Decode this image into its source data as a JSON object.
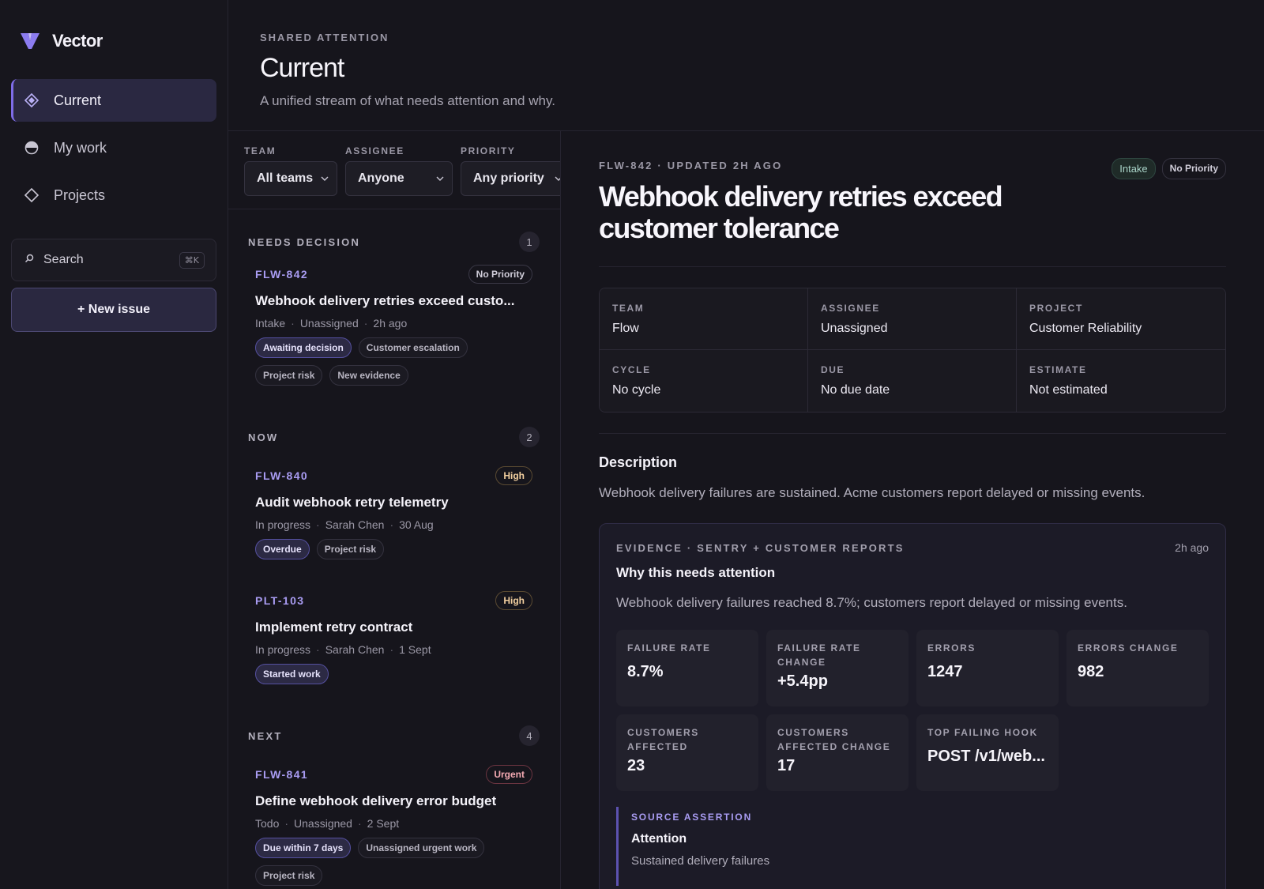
{
  "brand": {
    "name": "Vector"
  },
  "nav": [
    {
      "label": "Current",
      "icon": "diamond-filled-icon",
      "active": true
    },
    {
      "label": "My work",
      "icon": "half-circle-icon",
      "active": false
    },
    {
      "label": "Projects",
      "icon": "diamond-outline-icon",
      "active": false
    }
  ],
  "search": {
    "label": "Search",
    "shortcut": "⌘K"
  },
  "new_issue": {
    "label": "+ New issue"
  },
  "header": {
    "eyebrow": "SHARED ATTENTION",
    "title": "Current",
    "subtitle": "A unified stream of what needs attention and why."
  },
  "filters": [
    {
      "label": "TEAM",
      "value": "All teams"
    },
    {
      "label": "ASSIGNEE",
      "value": "Anyone"
    },
    {
      "label": "PRIORITY",
      "value": "Any priority"
    }
  ],
  "sections": [
    {
      "title": "NEEDS DECISION",
      "count": "1",
      "items": [
        {
          "id": "FLW-842",
          "priority": "No Priority",
          "title": "Webhook delivery retries exceed custo...",
          "meta": [
            "Intake",
            "Unassigned",
            "2h ago"
          ],
          "tags": [
            {
              "label": "Awaiting decision",
              "hl": true
            },
            {
              "label": "Customer escalation"
            },
            {
              "label": "Project risk"
            },
            {
              "label": "New evidence"
            }
          ]
        }
      ]
    },
    {
      "title": "NOW",
      "count": "2",
      "items": [
        {
          "id": "FLW-840",
          "priority": "High",
          "title": "Audit webhook retry telemetry",
          "meta": [
            "In progress",
            "Sarah Chen",
            "30 Aug"
          ],
          "tags": [
            {
              "label": "Overdue",
              "hl": true
            },
            {
              "label": "Project risk"
            }
          ]
        },
        {
          "id": "PLT-103",
          "priority": "High",
          "title": "Implement retry contract",
          "meta": [
            "In progress",
            "Sarah Chen",
            "1 Sept"
          ],
          "tags": [
            {
              "label": "Started work",
              "hl": true
            }
          ]
        }
      ]
    },
    {
      "title": "NEXT",
      "count": "4",
      "items": [
        {
          "id": "FLW-841",
          "priority": "Urgent",
          "title": "Define webhook delivery error budget",
          "meta": [
            "Todo",
            "Unassigned",
            "2 Sept"
          ],
          "tags": [
            {
              "label": "Due within 7 days",
              "hl": true
            },
            {
              "label": "Unassigned urgent work"
            },
            {
              "label": "Project risk"
            }
          ]
        }
      ]
    }
  ],
  "detail": {
    "eyebrow": "FLW-842 · UPDATED 2H AGO",
    "badges": [
      "Intake",
      "No Priority"
    ],
    "title": "Webhook delivery retries exceed customer tolerance",
    "props": [
      {
        "label": "TEAM",
        "value": "Flow"
      },
      {
        "label": "ASSIGNEE",
        "value": "Unassigned"
      },
      {
        "label": "PROJECT",
        "value": "Customer Reliability"
      },
      {
        "label": "CYCLE",
        "value": "No cycle"
      },
      {
        "label": "DUE",
        "value": "No due date"
      },
      {
        "label": "ESTIMATE",
        "value": "Not estimated"
      }
    ],
    "description_title": "Description",
    "description": "Webhook delivery failures are sustained. Acme customers report delayed or missing events.",
    "evidence": {
      "eyebrow": "EVIDENCE · SENTRY + CUSTOMER REPORTS",
      "time": "2h ago",
      "title": "Why this needs attention",
      "text": "Webhook delivery failures reached 8.7%; customers report delayed or missing events.",
      "metrics": [
        {
          "label": "FAILURE RATE",
          "value": "8.7%"
        },
        {
          "label": "FAILURE RATE CHANGE",
          "value": "+5.4pp"
        },
        {
          "label": "ERRORS",
          "value": "1247"
        },
        {
          "label": "ERRORS CHANGE",
          "value": "982"
        },
        {
          "label": "CUSTOMERS AFFECTED",
          "value": "23"
        },
        {
          "label": "CUSTOMERS AFFECTED CHANGE",
          "value": "17"
        },
        {
          "label": "TOP FAILING HOOK",
          "value": "POST /v1/web..."
        }
      ],
      "assertion": {
        "eyebrow": "SOURCE ASSERTION",
        "title": "Attention",
        "text": "Sustained delivery failures"
      }
    }
  },
  "colors": {
    "accent": "#7e6ce8",
    "background": "#16151c",
    "id_text": "#a99cf2"
  }
}
